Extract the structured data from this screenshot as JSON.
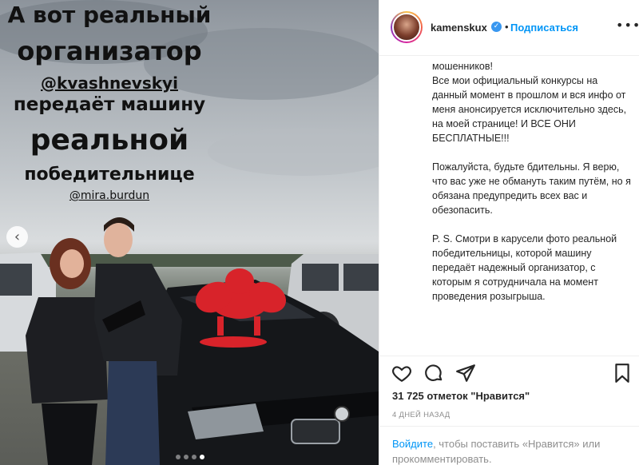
{
  "story": {
    "lines": [
      "А вот реальный",
      "организатор",
      "@kvashnevskyi",
      "передаёт машину",
      "реальной",
      "победительнице",
      "@mira.burdun"
    ],
    "prev_arrow": "‹",
    "dots_total": 4,
    "dots_active": 4
  },
  "post": {
    "username": "kamenskux",
    "verified_mark": "✓",
    "separator": "•",
    "follow_label": "Подписаться",
    "more_label": "•••",
    "caption_paragraphs": [
      "мошенников!\nВсе мои официальный конкурсы на данный момент в прошлом и вся инфо от меня анонсируется исключительно здесь, на моей странице! И ВСЕ ОНИ БЕСПЛАТНЫЕ!!!",
      "Пожалуйста, будьте бдительны. Я верю, что вас уже не обмануть таким путём, но я обязана предупредить всех вас и обезопасить.",
      "P. S. Смотри в карусели фото реальной победительницы, которой машину передаёт надежный организатор, с которым я сотрудничала на момент проведения розыгрыша."
    ],
    "likes_text": "31 725 отметок \"Нравится\"",
    "date_text": "4 ДНЕЙ НАЗАД",
    "login_link": "Войдите",
    "login_rest": ", чтобы поставить «Нравится» или прокомментировать."
  },
  "icons": [
    "heart-icon",
    "comment-icon",
    "share-icon",
    "bookmark-icon"
  ],
  "colors": {
    "accent": "#0095f6",
    "text": "#262626",
    "muted": "#8e8e8e",
    "bow": "#d8232a"
  }
}
